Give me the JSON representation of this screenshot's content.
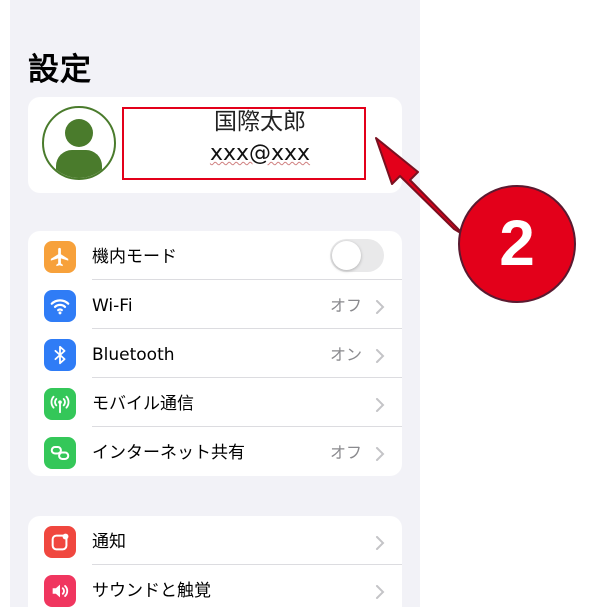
{
  "title": "設定",
  "profile": {
    "name": "国際太郎",
    "email": "xxx@xxx"
  },
  "step_number": "2",
  "colors": {
    "highlight": "#e3001a",
    "badge": "#e3001a",
    "avatar": "#4a7b2c"
  },
  "groups": [
    {
      "items": [
        {
          "icon": "airplane-icon",
          "icon_color": "#f7a13b",
          "label": "機内モード",
          "control": "toggle",
          "toggle_on": false
        },
        {
          "icon": "wifi-icon",
          "icon_color": "#2f7cf6",
          "label": "Wi-Fi",
          "value": "オフ"
        },
        {
          "icon": "bluetooth-icon",
          "icon_color": "#2f7cf6",
          "label": "Bluetooth",
          "value": "オン"
        },
        {
          "icon": "cellular-icon",
          "icon_color": "#34c759",
          "label": "モバイル通信"
        },
        {
          "icon": "personal-hotspot-icon",
          "icon_color": "#34c759",
          "label": "インターネット共有",
          "value": "オフ"
        }
      ]
    },
    {
      "items": [
        {
          "icon": "notifications-icon",
          "icon_color": "#f0473f",
          "label": "通知"
        },
        {
          "icon": "sounds-icon",
          "icon_color": "#f0365f",
          "label": "サウンドと触覚"
        }
      ]
    }
  ]
}
